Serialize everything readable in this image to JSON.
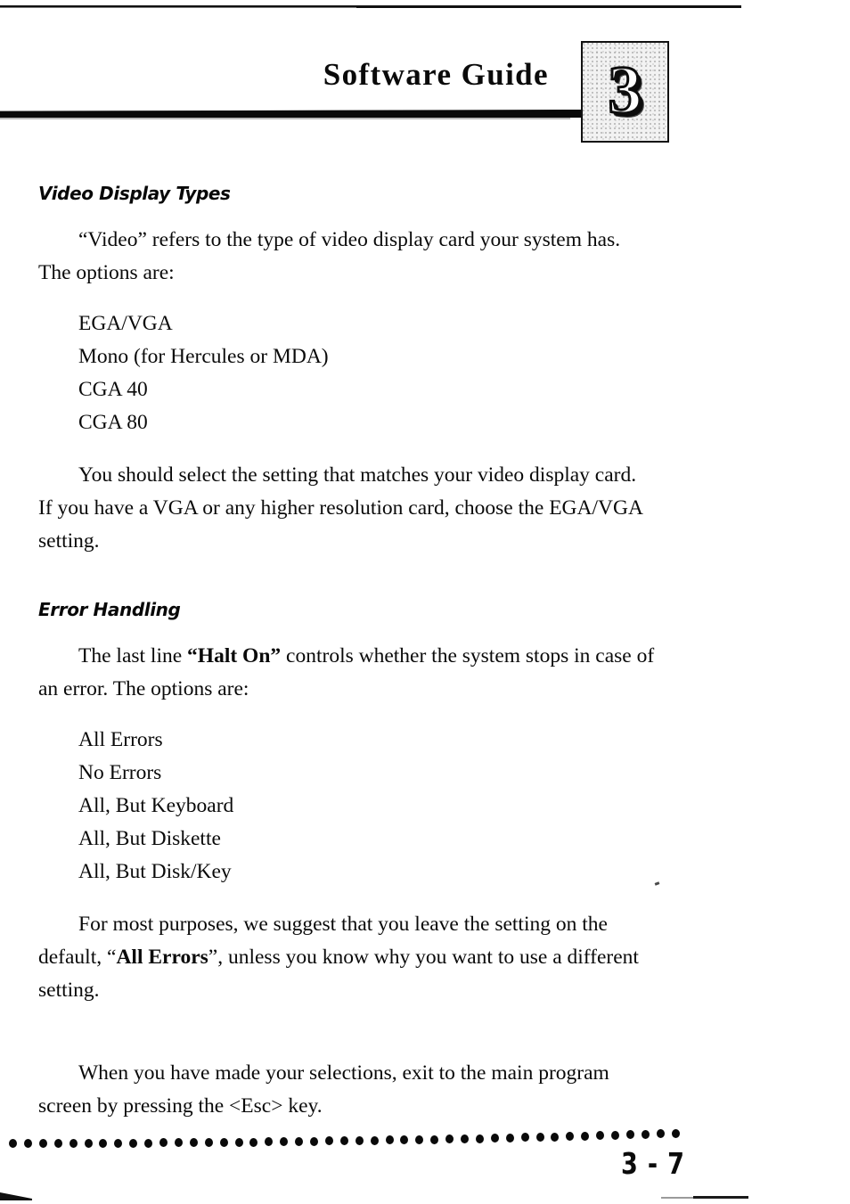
{
  "document": {
    "header": {
      "title": "Software Guide",
      "chapter_number": "3"
    },
    "sections": [
      {
        "heading": "Video Display Types",
        "intro": {
          "text_before_quote": "“Video” refers to the type of video display card your system has. The options are:"
        },
        "options": [
          "EGA/VGA",
          "Mono (for Hercules or MDA)",
          "CGA 40",
          "CGA 80"
        ],
        "closing_paragraph": "You should select the setting that matches your video display card. If you have a VGA or any higher resolution card, choose the EGA/VGA setting."
      },
      {
        "heading": "Error Handling",
        "intro_part1": "The last line ",
        "intro_bold": "“Halt On”",
        "intro_part2": " controls whether the system stops in case of an error. The options are:",
        "options": [
          "All Errors",
          "No Errors",
          "All, But Keyboard",
          "All, But Diskette",
          "All, But Disk/Key"
        ],
        "closing_part1": "For most purposes, we suggest that you leave the setting on the default, “",
        "closing_bold": "All Errors",
        "closing_part2": "”, unless you know why you want to use a different setting."
      }
    ],
    "final_paragraph": "When you have made your selections, exit to the main program screen by pressing the <Esc> key.",
    "footer": {
      "page_number": "3 - 7",
      "dot_count": 45
    }
  },
  "colors": {
    "ink": "#0a0a0a",
    "page_background": "#ffffff",
    "tab_fill": "#f2f2f2"
  }
}
